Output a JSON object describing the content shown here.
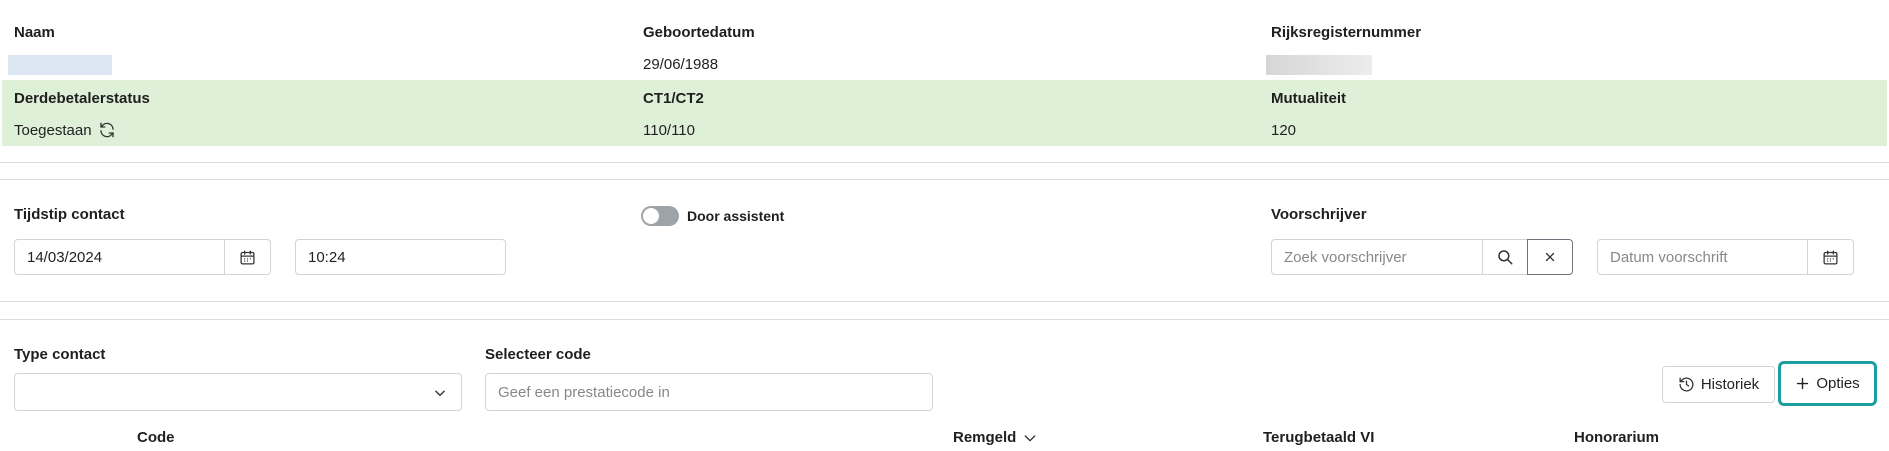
{
  "patient": {
    "naam_label": "Naam",
    "geboortedatum_label": "Geboortedatum",
    "geboortedatum_value": "29/06/1988",
    "rijksregister_label": "Rijksregisternummer"
  },
  "insurance": {
    "derdebetaler_label": "Derdebetalerstatus",
    "derdebetaler_value": "Toegestaan",
    "ct_label": "CT1/CT2",
    "ct_value": "110/110",
    "mutualiteit_label": "Mutualiteit",
    "mutualiteit_value": "120"
  },
  "contact": {
    "tijdstip_label": "Tijdstip contact",
    "date_value": "14/03/2024",
    "time_value": "10:24",
    "door_assistent_label": "Door assistent",
    "door_assistent_on": false,
    "voorschrijver_label": "Voorschrijver",
    "voorschrijver_placeholder": "Zoek voorschrijver",
    "datum_voorschrift_placeholder": "Datum voorschrift"
  },
  "prestatie": {
    "type_contact_label": "Type contact",
    "type_contact_value": "",
    "selecteer_code_label": "Selecteer code",
    "code_placeholder": "Geef een prestatiecode in",
    "historiek_label": "Historiek",
    "opties_label": "Opties"
  },
  "table": {
    "columns": [
      "Code",
      "Remgeld",
      "Terugbetaald VI",
      "Honorarium"
    ]
  },
  "colors": {
    "green_band": "#dff0d8",
    "focus_teal": "#1a9ea0"
  },
  "icons": [
    "refresh-icon",
    "calendar-icon",
    "search-icon",
    "close-icon",
    "chevron-down-icon",
    "history-icon",
    "plus-icon"
  ]
}
